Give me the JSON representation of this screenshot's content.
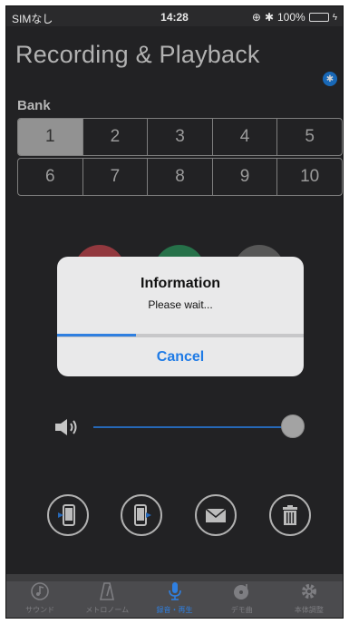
{
  "status_bar": {
    "carrier": "SIMなし",
    "time": "14:28",
    "battery": "100%"
  },
  "header": {
    "title": "Recording & Playback"
  },
  "bank": {
    "label": "Bank",
    "selected": "1",
    "row1": [
      "1",
      "2",
      "3",
      "4",
      "5"
    ],
    "row2": [
      "6",
      "7",
      "8",
      "9",
      "10"
    ]
  },
  "dialog": {
    "title": "Information",
    "message": "Please wait...",
    "progress": 0.32,
    "cancel_label": "Cancel"
  },
  "volume": {
    "level": 1.0
  },
  "actions": [
    {
      "icon": "phone-import-icon"
    },
    {
      "icon": "phone-export-icon"
    },
    {
      "icon": "mail-icon"
    },
    {
      "icon": "trash-icon"
    }
  ],
  "tab_bar": {
    "tabs": [
      {
        "label": "サウンド",
        "icon": "music-note-icon"
      },
      {
        "label": "メトロノーム",
        "icon": "metronome-icon"
      },
      {
        "label": "録音・再生",
        "icon": "microphone-icon"
      },
      {
        "label": "デモ曲",
        "icon": "demo-disc-icon"
      },
      {
        "label": "本体調整",
        "icon": "gear-icon"
      }
    ],
    "active_index": 2
  },
  "colors": {
    "accent": "#2f7fe0",
    "background": "#2a2a2c",
    "tab_bar": "#4b4b4e"
  }
}
